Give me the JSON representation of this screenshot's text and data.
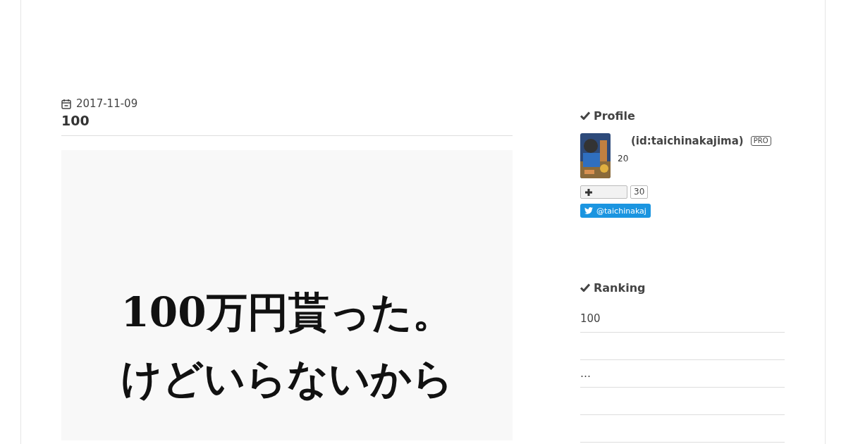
{
  "entry": {
    "date": "2017-11-09",
    "title": "100",
    "eyecatch": {
      "kind": "picture",
      "lines": [
        "100万円貰った。",
        "けどいらないから"
      ]
    }
  },
  "sidebar": {
    "profile": {
      "heading": "Profile",
      "name": "(id:taichinakajima)",
      "badge": "PRO",
      "description": "20",
      "bookmark_count": "30",
      "twitter": "@taichinakaj"
    },
    "ranking": {
      "heading": "Ranking",
      "rows": [
        {
          "kind": "text",
          "title": "100"
        },
        {
          "kind": "blank"
        },
        {
          "kind": "text",
          "title": "…"
        },
        {
          "kind": "blank"
        },
        {
          "kind": "blank"
        }
      ]
    }
  }
}
